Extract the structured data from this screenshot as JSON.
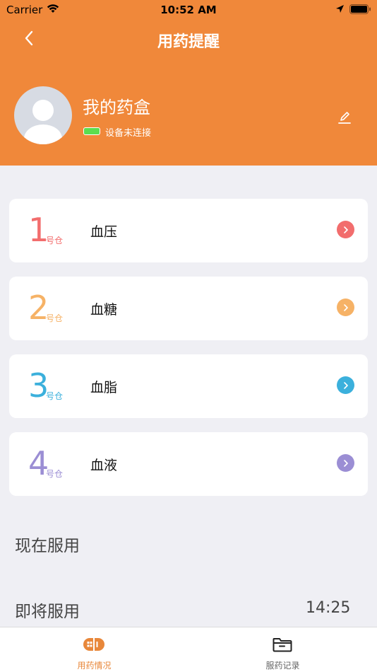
{
  "status_bar": {
    "carrier": "Carrier",
    "time": "10:52 AM"
  },
  "nav": {
    "title": "用药提醒"
  },
  "profile": {
    "device_name": "我的药盒",
    "device_status": "设备未连接"
  },
  "compartments": [
    {
      "number": "1",
      "suffix": "号仓",
      "label": "血压",
      "color": "#f26d6d"
    },
    {
      "number": "2",
      "suffix": "号仓",
      "label": "血糖",
      "color": "#f6b266"
    },
    {
      "number": "3",
      "suffix": "号仓",
      "label": "血脂",
      "color": "#3bb0dc"
    },
    {
      "number": "4",
      "suffix": "号仓",
      "label": "血液",
      "color": "#9b8ed4"
    }
  ],
  "sections": {
    "now_label": "现在服用",
    "soon_label": "即将服用",
    "soon_time": "14:25"
  },
  "tabs": [
    {
      "label": "用药情况",
      "icon": "pill-icon",
      "active": true
    },
    {
      "label": "服药记录",
      "icon": "folder-icon",
      "active": false
    }
  ],
  "colors": {
    "header": "#f0883a",
    "tab_active": "#e8873a",
    "tab_inactive": "#666666"
  }
}
